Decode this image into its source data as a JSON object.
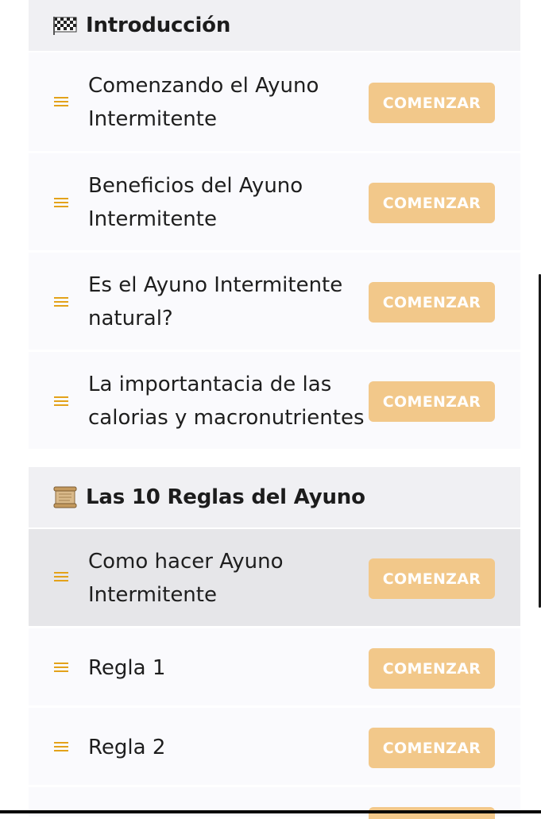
{
  "sections": [
    {
      "icon": "checkered-flag-icon",
      "title": "Introducción",
      "items": [
        {
          "line1": "Comenzando el Ayuno",
          "line2": "Intermitente",
          "button": "COMENZAR"
        },
        {
          "line1": "Beneficios del Ayuno",
          "line2": "Intermitente",
          "button": "COMENZAR"
        },
        {
          "line1": "Es el Ayuno Intermitente",
          "line2": "natural?",
          "button": "COMENZAR"
        },
        {
          "line1": "La importantacia de las",
          "line2": "calorias y macronutrientes",
          "button": "COMENZAR"
        }
      ]
    },
    {
      "icon": "scroll-icon",
      "title": "Las 10 Reglas del Ayuno",
      "items": [
        {
          "line1": "Como hacer Ayuno",
          "line2": "Intermitente",
          "button": "COMENZAR"
        },
        {
          "line1": "Regla 1",
          "button": "COMENZAR"
        },
        {
          "line1": "Regla 2",
          "button": "COMENZAR"
        }
      ]
    }
  ],
  "colors": {
    "accent_icon": "#e3a21a",
    "button_bg": "#f2c88a",
    "button_text": "#ffffff",
    "header_bg": "#f0f0f3",
    "item_bg": "#fafafd",
    "highlight_bg": "#e6e6e9"
  }
}
